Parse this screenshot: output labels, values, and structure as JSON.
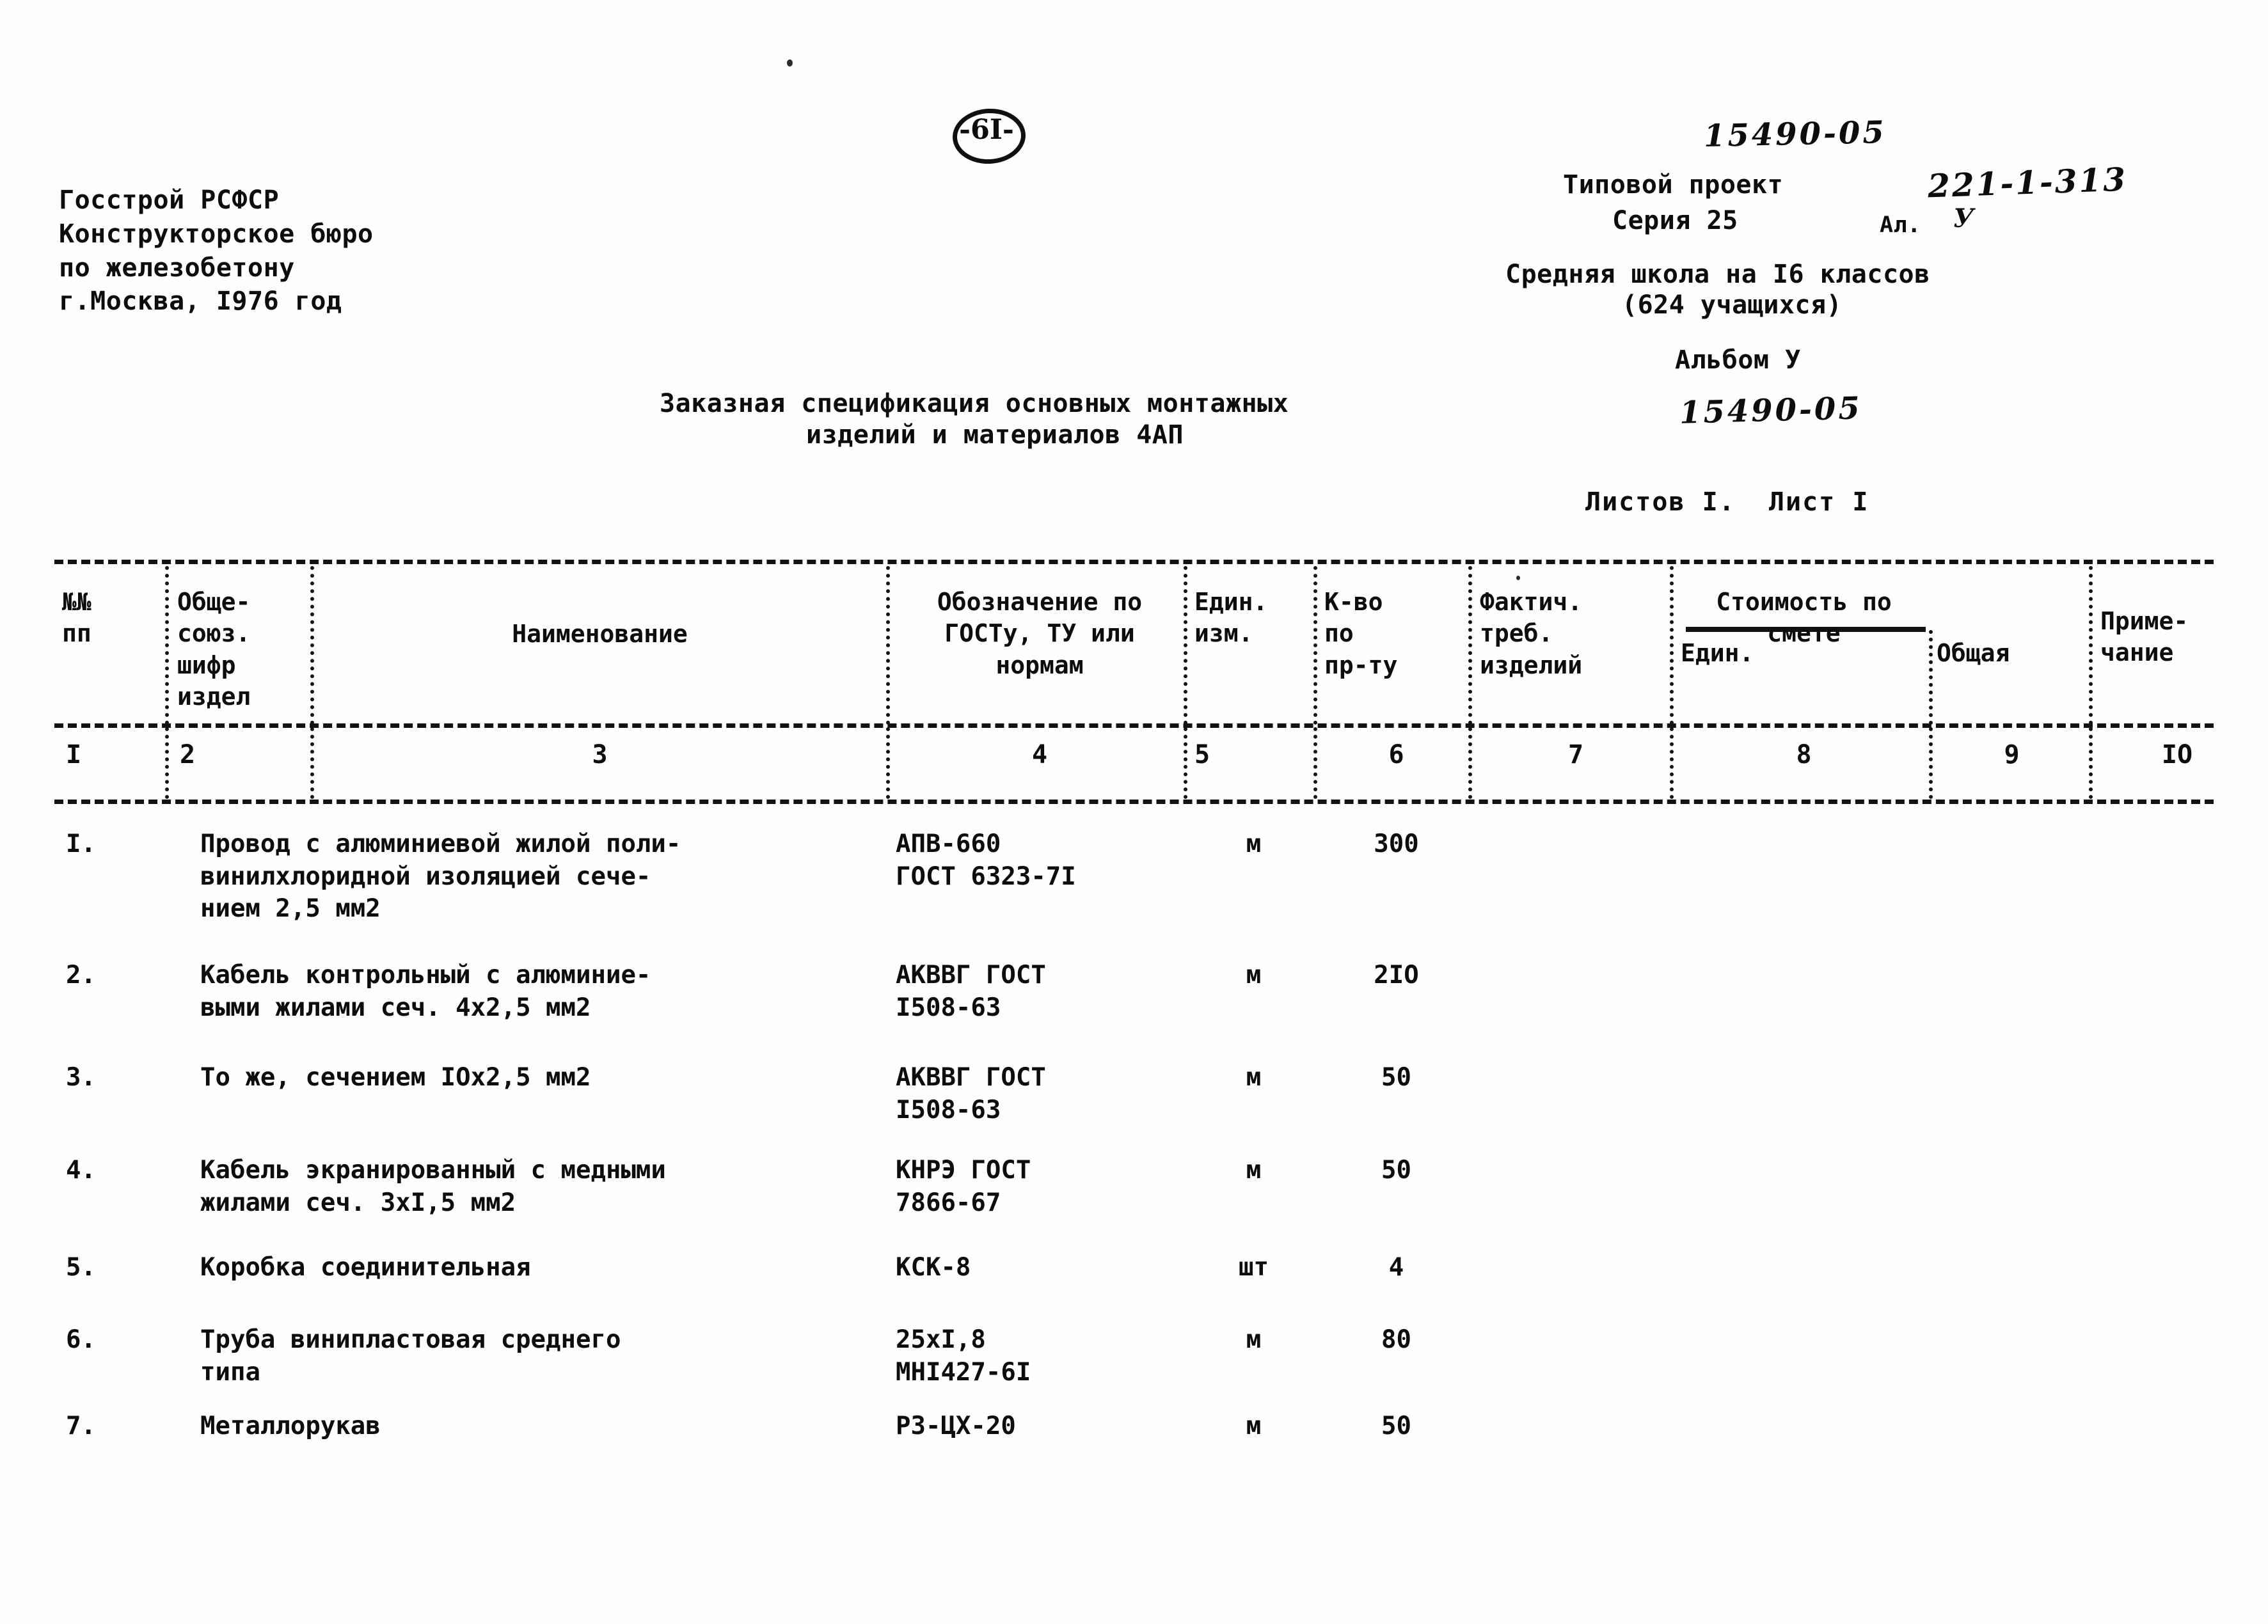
{
  "page": {
    "page_number_mark": "-6I-"
  },
  "header": {
    "organization": "Госстрой РСФСР\nКонструкторское бюро\nпо железобетону\nг.Москва, I976 год",
    "project_code_handwritten": "15490-05",
    "project_label": "Типовой проект",
    "project_number_handwritten": "221-1-313",
    "series_label": "Серия 25",
    "album_short_label": "Ал.",
    "album_short_value": "У",
    "school_line": "Средняя школа на I6 классов",
    "pupils_line": "(624 учащихся)",
    "album_line": "Альбом У",
    "album_code_handwritten": "15490-05",
    "sheets_line": "Листов I.  Лист I"
  },
  "title": {
    "line1": "Заказная спецификация основных монтажных",
    "line2": "изделий и материалов 4АП"
  },
  "table": {
    "headers": {
      "col1": "№№\nпп",
      "col2": "Обще-\nсоюз.\nшифр\nиздел",
      "col3": "Наименование",
      "col4": "Обозначение по\nГОСТу, ТУ или\nнормам",
      "col5": "Един.\nизм.",
      "col6": "К-во\nпо\nпр-ту",
      "col7": "Фактич.\nтреб.\nизделий",
      "col8_9_group": "Стоимость по\nсмете",
      "col8": "Един.",
      "col9": "Общая",
      "col10": "Приме-\nчание"
    },
    "column_numbers": [
      "I",
      "2",
      "3",
      "4",
      "5",
      "6",
      "7",
      "8",
      "9",
      "IO"
    ],
    "rows": [
      {
        "no": "I.",
        "code": "",
        "name": "Провод с алюминиевой жилой поли-\nвинилхлоридной изоляцией сече-\nнием 2,5 мм2",
        "standard": "АПВ-660\nГОСТ 6323-7I",
        "unit": "м",
        "qty": "300",
        "actual": "",
        "price_unit": "",
        "price_total": "",
        "note": ""
      },
      {
        "no": "2.",
        "code": "",
        "name": "Кабель контрольный с алюминие-\nвыми жилами сеч. 4х2,5 мм2",
        "standard": "АКВВГ ГОСТ\nI508-63",
        "unit": "м",
        "qty": "2IO",
        "actual": "",
        "price_unit": "",
        "price_total": "",
        "note": ""
      },
      {
        "no": "3.",
        "code": "",
        "name": "То же, сечением IOх2,5 мм2",
        "standard": "АКВВГ ГОСТ\nI508-63",
        "unit": "м",
        "qty": "50",
        "actual": "",
        "price_unit": "",
        "price_total": "",
        "note": ""
      },
      {
        "no": "4.",
        "code": "",
        "name": "Кабель экранированный с медными\nжилами сеч. 3хI,5 мм2",
        "standard": "КНРЭ ГОСТ\n7866-67",
        "unit": "м",
        "qty": "50",
        "actual": "",
        "price_unit": "",
        "price_total": "",
        "note": ""
      },
      {
        "no": "5.",
        "code": "",
        "name": "Коробка соединительная",
        "standard": "КСК-8",
        "unit": "шт",
        "qty": "4",
        "actual": "",
        "price_unit": "",
        "price_total": "",
        "note": ""
      },
      {
        "no": "6.",
        "code": "",
        "name": "Труба винипластовая среднего\nтипа",
        "standard": "25хI,8\nМНI427-6I",
        "unit": "м",
        "qty": "80",
        "actual": "",
        "price_unit": "",
        "price_total": "",
        "note": ""
      },
      {
        "no": "7.",
        "code": "",
        "name": "Металлорукав",
        "standard": "РЗ-ЦХ-20",
        "unit": "м",
        "qty": "50",
        "actual": "",
        "price_unit": "",
        "price_total": "",
        "note": ""
      }
    ]
  }
}
